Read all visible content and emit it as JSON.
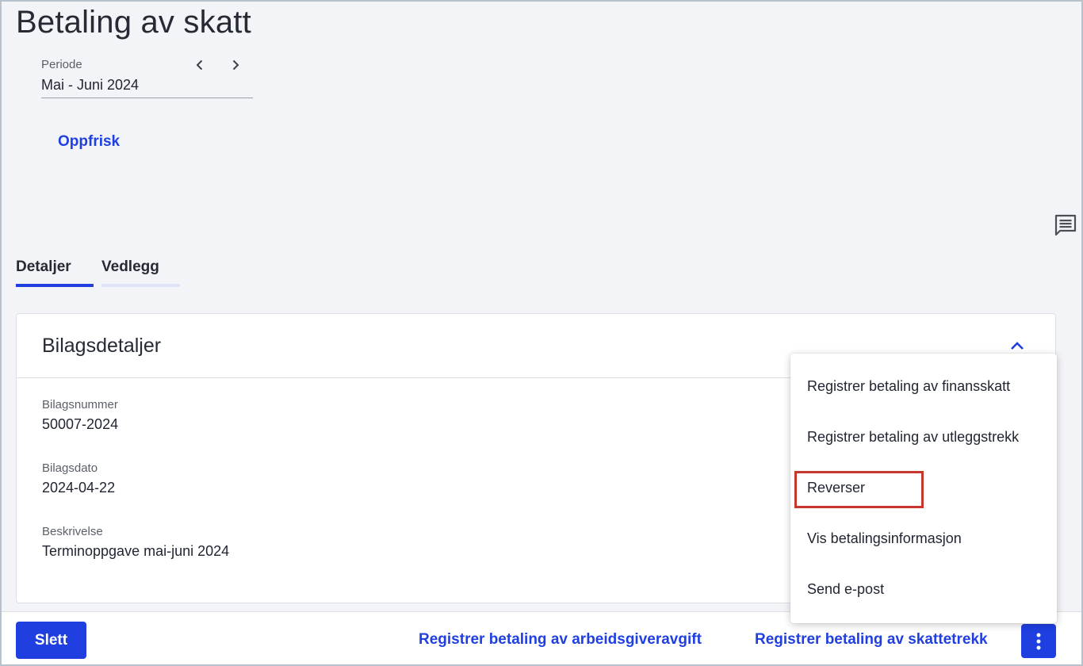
{
  "page": {
    "title": "Betaling av skatt"
  },
  "period": {
    "label": "Periode",
    "value": "Mai - Juni 2024",
    "prev_icon": "chevron-left-icon",
    "next_icon": "chevron-right-icon"
  },
  "refresh_label": "Oppfrisk",
  "comment_icon": "comment-icon",
  "tabs": [
    {
      "label": "Detaljer",
      "active": true
    },
    {
      "label": "Vedlegg",
      "active": false
    }
  ],
  "card": {
    "title": "Bilagsdetaljer",
    "collapse_icon": "chevron-up-icon",
    "fields": [
      {
        "label": "Bilagsnummer",
        "value": "50007-2024"
      },
      {
        "label": "Bilagsdato",
        "value": "2024-04-22"
      },
      {
        "label": "Beskrivelse",
        "value": "Terminoppgave mai-juni 2024"
      }
    ]
  },
  "menu": {
    "items": [
      {
        "label": "Registrer betaling av finansskatt"
      },
      {
        "label": "Registrer betaling av utleggstrekk"
      },
      {
        "label": "Reverser",
        "highlighted": true
      },
      {
        "label": "Vis betalingsinformasjon"
      },
      {
        "label": "Send e-post"
      }
    ]
  },
  "footer": {
    "delete_label": "Slett",
    "employer_fee_label": "Registrer betaling av arbeidsgiveravgift",
    "tax_deduction_label": "Registrer betaling av skattetrekk",
    "more_icon": "more-vertical-icon"
  },
  "colors": {
    "accent": "#1f3fe0",
    "highlight_border": "#c8372d",
    "background": "#f3f4f7"
  }
}
